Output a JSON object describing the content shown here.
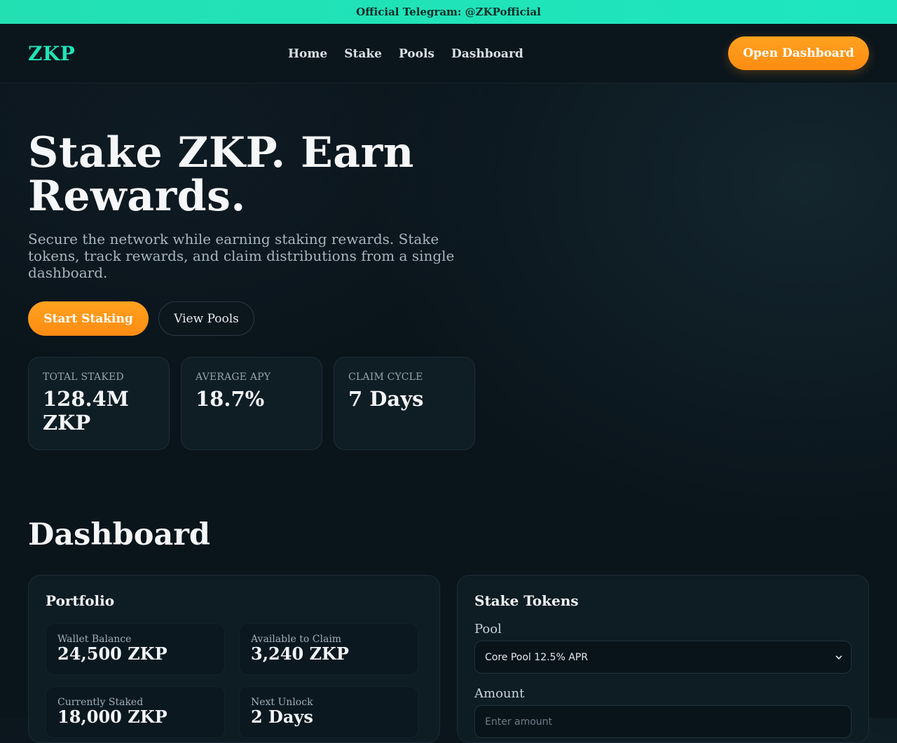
{
  "announcement": {
    "text": "Official Telegram: @ZKPofficial"
  },
  "nav": {
    "logo": "ZKP",
    "links": [
      "Home",
      "Stake",
      "Pools",
      "Dashboard"
    ],
    "cta": "Open Dashboard"
  },
  "hero": {
    "title_line1": "Stake ZKP. Earn",
    "title_line2": "Rewards.",
    "subtitle": "Secure the network while earning staking rewards. Stake tokens, track rewards, and claim distributions from a single dashboard.",
    "primary_button": "Start Staking",
    "secondary_button": "View Pools"
  },
  "stats": [
    {
      "label": "TOTAL STAKED",
      "value": "128.4M ZKP"
    },
    {
      "label": "AVERAGE APY",
      "value": "18.7%"
    },
    {
      "label": "CLAIM CYCLE",
      "value": "7 Days"
    }
  ],
  "dashboard": {
    "title": "Dashboard",
    "portfolio": {
      "title": "Portfolio",
      "items": [
        {
          "label": "Wallet Balance",
          "value": "24,500 ZKP"
        },
        {
          "label": "Available to Claim",
          "value": "3,240 ZKP"
        },
        {
          "label": "Currently Staked",
          "value": "18,000 ZKP"
        },
        {
          "label": "Next Unlock",
          "value": "2 Days"
        }
      ]
    },
    "stake": {
      "title": "Stake Tokens",
      "pool_label": "Pool",
      "pool_value": "Core Pool 12.5% APR",
      "amount_label": "Amount",
      "amount_placeholder": "Enter amount"
    }
  },
  "colors": {
    "accent_teal": "#22e2b6",
    "accent_orange": "#ff9a1a",
    "background": "#0a141b"
  }
}
